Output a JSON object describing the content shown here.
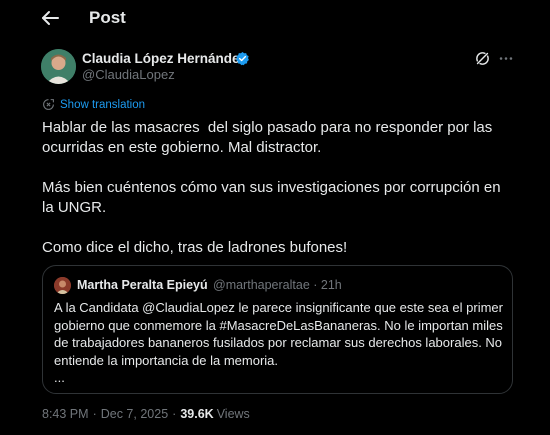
{
  "header": {
    "title": "Post",
    "back_icon": "arrow-left-icon"
  },
  "author": {
    "name": "Claudia López Hernández",
    "handle": "@ClaudiaLopez",
    "verified": true,
    "verified_color": "#1d9bf0"
  },
  "actions": {
    "grok_icon": "grok-icon",
    "more_icon": "more-horizontal-icon"
  },
  "translation": {
    "label": "Show translation",
    "icon": "globe-translate-icon"
  },
  "post": {
    "paragraphs": [
      "Hablar de las masacres  del siglo pasado para no responder por las ocurridas en este gobierno. Mal distractor.",
      "Más bien cuéntenos cómo van sus investigaciones por corrupción en la UNGR.",
      "Como dice el dicho, tras de ladrones bufones!"
    ]
  },
  "quote": {
    "name": "Martha Peralta Epieyú",
    "handle_time": "@marthaperaltae · 21h",
    "text_lines": [
      "A la Candidata @ClaudiaLopez le parece insignificante que este sea el primer",
      "gobierno que conmemore la #MasacreDeLasBananeras. No le importan miles",
      "de trabajadores bananeros fusilados por reclamar sus derechos laborales. No",
      "entiende la importancia de la memoria.",
      "..."
    ]
  },
  "meta": {
    "time": "8:43 PM",
    "separator": "·",
    "date": "Dec 7, 2025",
    "views_count": "39.6K",
    "views_label": "Views"
  },
  "colors": {
    "background": "#000000",
    "text_primary": "#e7e9ea",
    "text_secondary": "#71767b",
    "accent": "#1d9bf0",
    "border": "#2f3336"
  }
}
